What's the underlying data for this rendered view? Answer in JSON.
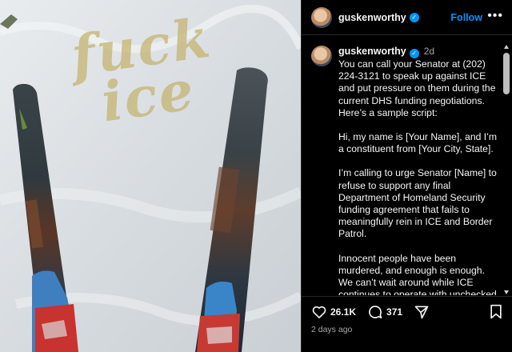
{
  "post": {
    "username": "guskenworthy",
    "age": "2d",
    "follow_label": "Follow",
    "more_label": "•••",
    "verified_mark": "✓",
    "photo_text": [
      "fuck",
      "ice"
    ],
    "caption": [
      "You can call your Senator at (202) 224-3121 to speak up against ICE and put pressure on them during the current DHS funding negotiations. Here’s a sample script:",
      "Hi, my name is [Your Name], and I’m a constituent from [Your City, State].",
      "I’m calling to urge Senator [Name] to refuse to support any final Department of Homeland Security funding agreement that fails to meaningfully rein in ICE and Border Patrol.",
      "Innocent people have been murdered, and enough is enough. We can’t wait around while ICE continues to operate with unchecked power in our communities. Senators still have leverage right now, and Senator"
    ],
    "likes": "26.1K",
    "comments": "371",
    "posted": "2 days ago"
  },
  "colors": {
    "background": "#000000",
    "accent": "#0095f6",
    "muted": "#a8a8a8",
    "text": "#f5f5f5"
  },
  "icons": [
    "heart-icon",
    "comment-icon",
    "share-icon",
    "bookmark-icon",
    "more-icon",
    "verified-icon"
  ]
}
